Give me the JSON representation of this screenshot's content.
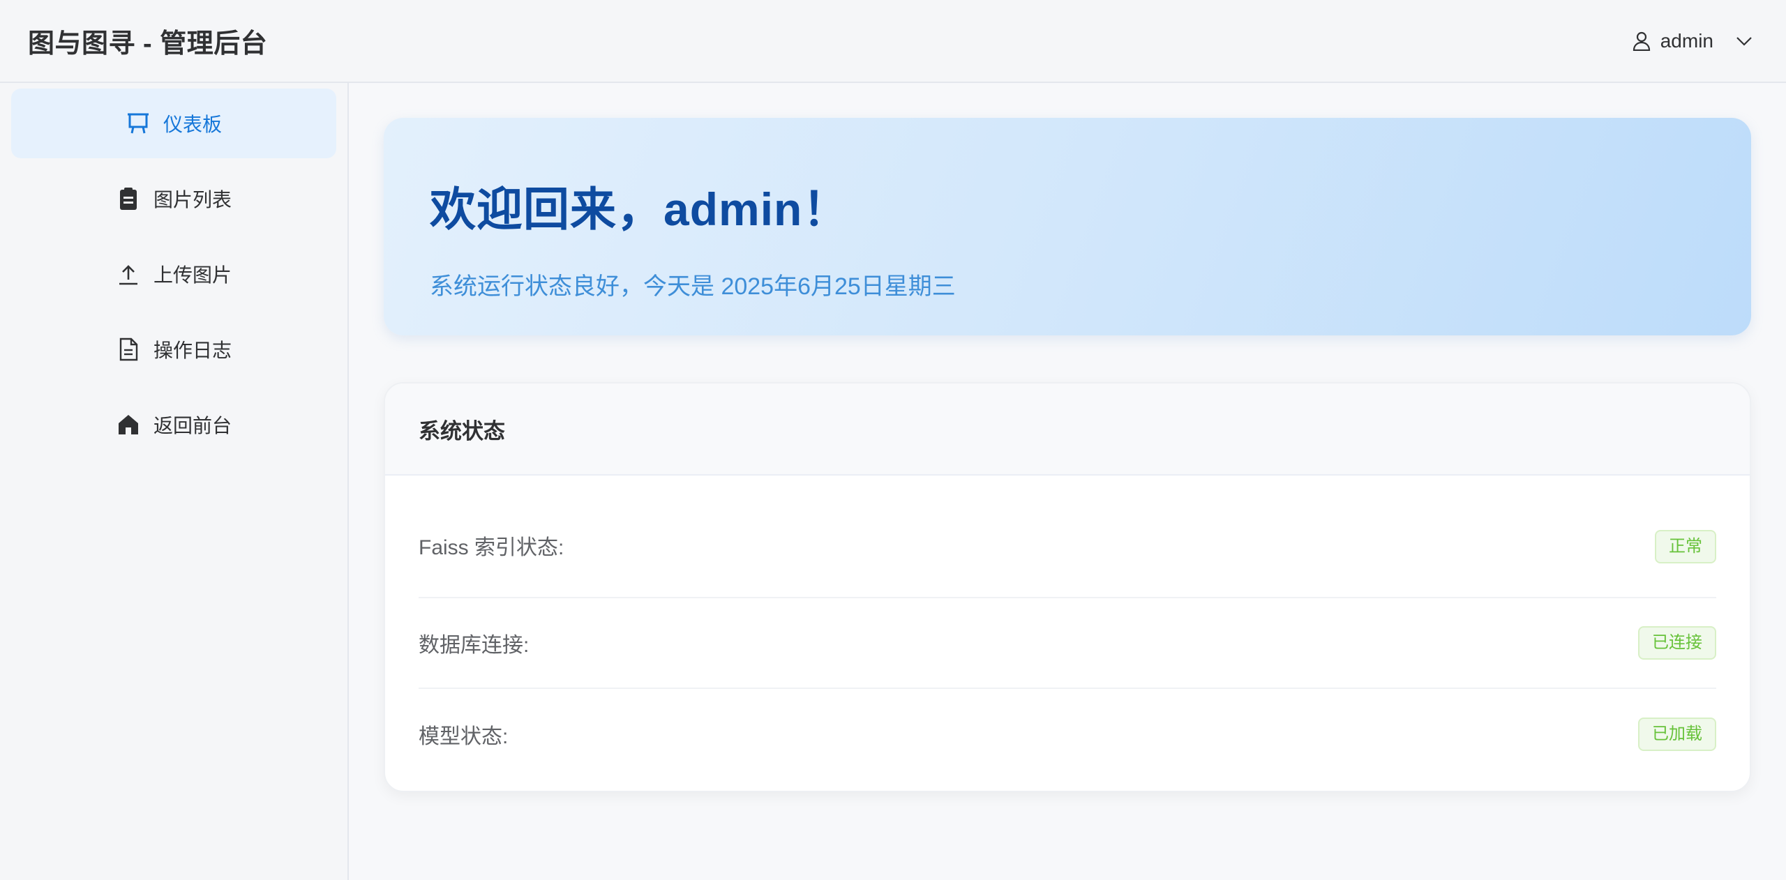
{
  "header": {
    "title": "图与图寻 - 管理后台",
    "user": "admin"
  },
  "sidebar": {
    "items": [
      {
        "label": "仪表板",
        "icon": "presentation-icon",
        "active": true
      },
      {
        "label": "图片列表",
        "icon": "clipboard-icon"
      },
      {
        "label": "上传图片",
        "icon": "upload-icon"
      },
      {
        "label": "操作日志",
        "icon": "document-icon"
      },
      {
        "label": "返回前台",
        "icon": "home-icon"
      }
    ]
  },
  "welcome": {
    "title": "欢迎回来，admin！",
    "subtitle": "系统运行状态良好，今天是 2025年6月25日星期三"
  },
  "status": {
    "title": "系统状态",
    "rows": [
      {
        "label": "Faiss 索引状态:",
        "badge": "正常"
      },
      {
        "label": "数据库连接:",
        "badge": "已连接"
      },
      {
        "label": "模型状态:",
        "badge": "已加载"
      }
    ]
  },
  "colors": {
    "accent": "#1677d9",
    "active_bg": "#e6f1fd",
    "success": "#67c23a",
    "welcome_title": "#0e4ba0"
  }
}
